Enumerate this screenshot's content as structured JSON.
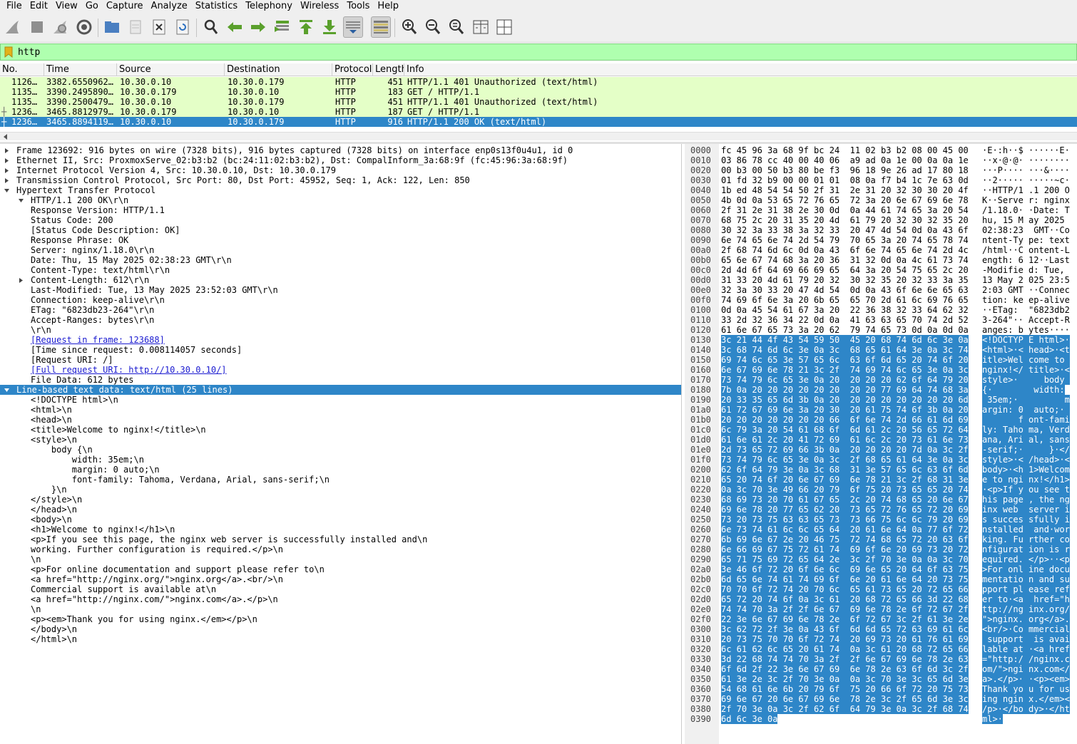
{
  "menu": [
    "File",
    "Edit",
    "View",
    "Go",
    "Capture",
    "Analyze",
    "Statistics",
    "Telephony",
    "Wireless",
    "Tools",
    "Help"
  ],
  "toolbar": {
    "buttons": [
      "start-capture",
      "stop-capture",
      "restart-capture",
      "capture-options",
      "open-file",
      "save-file",
      "close-file",
      "reload-file",
      "find-packet",
      "go-back",
      "go-forward",
      "go-to-packet",
      "first-packet",
      "last-packet",
      "auto-scroll",
      "colorize",
      "zoom-in",
      "zoom-out",
      "zoom-reset",
      "resize-columns",
      "layout"
    ]
  },
  "filter": {
    "value": "http"
  },
  "packet_list": {
    "columns": [
      "No.",
      "Time",
      "Source",
      "Destination",
      "Protocol",
      "Length",
      "Info"
    ],
    "rows": [
      {
        "mark": "",
        "no": "1126…",
        "time": "3382.6550962…",
        "source": "10.30.0.10",
        "destination": "10.30.0.179",
        "protocol": "HTTP",
        "length": "451",
        "info": "HTTP/1.1 401 Unauthorized  (text/html)",
        "selected": false
      },
      {
        "mark": "",
        "no": "1135…",
        "time": "3390.2495890…",
        "source": "10.30.0.179",
        "destination": "10.30.0.10",
        "protocol": "HTTP",
        "length": "183",
        "info": "GET / HTTP/1.1",
        "selected": false
      },
      {
        "mark": "",
        "no": "1135…",
        "time": "3390.2500479…",
        "source": "10.30.0.10",
        "destination": "10.30.0.179",
        "protocol": "HTTP",
        "length": "451",
        "info": "HTTP/1.1 401 Unauthorized  (text/html)",
        "selected": false
      },
      {
        "mark": "┼",
        "no": "1236…",
        "time": "3465.8812979…",
        "source": "10.30.0.179",
        "destination": "10.30.0.10",
        "protocol": "HTTP",
        "length": "187",
        "info": "GET / HTTP/1.1",
        "selected": false
      },
      {
        "mark": "┼",
        "no": "1236…",
        "time": "3465.8894119…",
        "source": "10.30.0.10",
        "destination": "10.30.0.179",
        "protocol": "HTTP",
        "length": "916",
        "info": "HTTP/1.1 200 OK  (text/html)",
        "selected": true
      }
    ]
  },
  "details": [
    {
      "indent": 0,
      "arrow": "right",
      "text": "Frame 123692: 916 bytes on wire (7328 bits), 916 bytes captured (7328 bits) on interface enp0s13f0u4u1, id 0"
    },
    {
      "indent": 0,
      "arrow": "right",
      "text": "Ethernet II, Src: ProxmoxServe_02:b3:b2 (bc:24:11:02:b3:b2), Dst: CompalInform_3a:68:9f (fc:45:96:3a:68:9f)"
    },
    {
      "indent": 0,
      "arrow": "right",
      "text": "Internet Protocol Version 4, Src: 10.30.0.10, Dst: 10.30.0.179"
    },
    {
      "indent": 0,
      "arrow": "right",
      "text": "Transmission Control Protocol, Src Port: 80, Dst Port: 45952, Seq: 1, Ack: 122, Len: 850"
    },
    {
      "indent": 0,
      "arrow": "down",
      "text": "Hypertext Transfer Protocol"
    },
    {
      "indent": 1,
      "arrow": "down",
      "text": "HTTP/1.1 200 OK\\r\\n"
    },
    {
      "indent": 2,
      "arrow": "",
      "text": "Response Version: HTTP/1.1"
    },
    {
      "indent": 2,
      "arrow": "",
      "text": "Status Code: 200"
    },
    {
      "indent": 2,
      "arrow": "",
      "text": "[Status Code Description: OK]"
    },
    {
      "indent": 2,
      "arrow": "",
      "text": "Response Phrase: OK"
    },
    {
      "indent": 1,
      "arrow": "",
      "text": "Server: nginx/1.18.0\\r\\n"
    },
    {
      "indent": 1,
      "arrow": "",
      "text": "Date: Thu, 15 May 2025 02:38:23 GMT\\r\\n"
    },
    {
      "indent": 1,
      "arrow": "",
      "text": "Content-Type: text/html\\r\\n"
    },
    {
      "indent": 1,
      "arrow": "right",
      "text": "Content-Length: 612\\r\\n"
    },
    {
      "indent": 1,
      "arrow": "",
      "text": "Last-Modified: Tue, 13 May 2025 23:52:03 GMT\\r\\n"
    },
    {
      "indent": 1,
      "arrow": "",
      "text": "Connection: keep-alive\\r\\n"
    },
    {
      "indent": 1,
      "arrow": "",
      "text": "ETag: \"6823db23-264\"\\r\\n"
    },
    {
      "indent": 1,
      "arrow": "",
      "text": "Accept-Ranges: bytes\\r\\n"
    },
    {
      "indent": 1,
      "arrow": "",
      "text": "\\r\\n"
    },
    {
      "indent": 1,
      "arrow": "",
      "text": "[Request in frame: 123688]",
      "link": true
    },
    {
      "indent": 1,
      "arrow": "",
      "text": "[Time since request: 0.008114057 seconds]"
    },
    {
      "indent": 1,
      "arrow": "",
      "text": "[Request URI: /]"
    },
    {
      "indent": 1,
      "arrow": "",
      "text": "[Full request URI: http://10.30.0.10/]",
      "link": true
    },
    {
      "indent": 1,
      "arrow": "",
      "text": "File Data: 612 bytes"
    },
    {
      "indent": 0,
      "arrow": "down",
      "text": "Line-based text data: text/html (25 lines)",
      "selected": true
    },
    {
      "indent": 1,
      "arrow": "",
      "text": "<!DOCTYPE html>\\n"
    },
    {
      "indent": 1,
      "arrow": "",
      "text": "<html>\\n"
    },
    {
      "indent": 1,
      "arrow": "",
      "text": "<head>\\n"
    },
    {
      "indent": 1,
      "arrow": "",
      "text": "<title>Welcome to nginx!</title>\\n"
    },
    {
      "indent": 1,
      "arrow": "",
      "text": "<style>\\n"
    },
    {
      "indent": 1,
      "arrow": "",
      "text": "    body {\\n"
    },
    {
      "indent": 1,
      "arrow": "",
      "text": "        width: 35em;\\n"
    },
    {
      "indent": 1,
      "arrow": "",
      "text": "        margin: 0 auto;\\n"
    },
    {
      "indent": 1,
      "arrow": "",
      "text": "        font-family: Tahoma, Verdana, Arial, sans-serif;\\n"
    },
    {
      "indent": 1,
      "arrow": "",
      "text": "    }\\n"
    },
    {
      "indent": 1,
      "arrow": "",
      "text": "</style>\\n"
    },
    {
      "indent": 1,
      "arrow": "",
      "text": "</head>\\n"
    },
    {
      "indent": 1,
      "arrow": "",
      "text": "<body>\\n"
    },
    {
      "indent": 1,
      "arrow": "",
      "text": "<h1>Welcome to nginx!</h1>\\n"
    },
    {
      "indent": 1,
      "arrow": "",
      "text": "<p>If you see this page, the nginx web server is successfully installed and\\n"
    },
    {
      "indent": 1,
      "arrow": "",
      "text": "working. Further configuration is required.</p>\\n"
    },
    {
      "indent": 1,
      "arrow": "",
      "text": "\\n"
    },
    {
      "indent": 1,
      "arrow": "",
      "text": "<p>For online documentation and support please refer to\\n"
    },
    {
      "indent": 1,
      "arrow": "",
      "text": "<a href=\"http://nginx.org/\">nginx.org</a>.<br/>\\n"
    },
    {
      "indent": 1,
      "arrow": "",
      "text": "Commercial support is available at\\n"
    },
    {
      "indent": 1,
      "arrow": "",
      "text": "<a href=\"http://nginx.com/\">nginx.com</a>.</p>\\n"
    },
    {
      "indent": 1,
      "arrow": "",
      "text": "\\n"
    },
    {
      "indent": 1,
      "arrow": "",
      "text": "<p><em>Thank you for using nginx.</em></p>\\n"
    },
    {
      "indent": 1,
      "arrow": "",
      "text": "</body>\\n"
    },
    {
      "indent": 1,
      "arrow": "",
      "text": "</html>\\n"
    }
  ],
  "bytes": {
    "highlight_start": 304,
    "rows": [
      {
        "offset": "0000",
        "hex": "fc 45 96 3a 68 9f bc 24  11 02 b3 b2 08 00 45 00",
        "ascii": "·E·:h··$ ······E·"
      },
      {
        "offset": "0010",
        "hex": "03 86 78 cc 40 00 40 06  a9 ad 0a 1e 00 0a 0a 1e",
        "ascii": "··x·@·@· ········"
      },
      {
        "offset": "0020",
        "hex": "00 b3 00 50 b3 80 be f3  96 18 9e 26 ad 17 80 18",
        "ascii": "···P···· ···&····"
      },
      {
        "offset": "0030",
        "hex": "01 fd 32 b9 00 00 01 01  08 0a f7 b4 1c 7e 63 0d",
        "ascii": "··2····· ·····~c·"
      },
      {
        "offset": "0040",
        "hex": "1b ed 48 54 54 50 2f 31  2e 31 20 32 30 30 20 4f",
        "ascii": "··HTTP/1 .1 200 O"
      },
      {
        "offset": "0050",
        "hex": "4b 0d 0a 53 65 72 76 65  72 3a 20 6e 67 69 6e 78",
        "ascii": "K··Serve r: nginx"
      },
      {
        "offset": "0060",
        "hex": "2f 31 2e 31 38 2e 30 0d  0a 44 61 74 65 3a 20 54",
        "ascii": "/1.18.0· ·Date: T"
      },
      {
        "offset": "0070",
        "hex": "68 75 2c 20 31 35 20 4d  61 79 20 32 30 32 35 20",
        "ascii": "hu, 15 M ay 2025 "
      },
      {
        "offset": "0080",
        "hex": "30 32 3a 33 38 3a 32 33  20 47 4d 54 0d 0a 43 6f",
        "ascii": "02:38:23  GMT··Co"
      },
      {
        "offset": "0090",
        "hex": "6e 74 65 6e 74 2d 54 79  70 65 3a 20 74 65 78 74",
        "ascii": "ntent-Ty pe: text"
      },
      {
        "offset": "00a0",
        "hex": "2f 68 74 6d 6c 0d 0a 43  6f 6e 74 65 6e 74 2d 4c",
        "ascii": "/html··C ontent-L"
      },
      {
        "offset": "00b0",
        "hex": "65 6e 67 74 68 3a 20 36  31 32 0d 0a 4c 61 73 74",
        "ascii": "ength: 6 12··Last"
      },
      {
        "offset": "00c0",
        "hex": "2d 4d 6f 64 69 66 69 65  64 3a 20 54 75 65 2c 20",
        "ascii": "-Modifie d: Tue, "
      },
      {
        "offset": "00d0",
        "hex": "31 33 20 4d 61 79 20 32  30 32 35 20 32 33 3a 35",
        "ascii": "13 May 2 025 23:5"
      },
      {
        "offset": "00e0",
        "hex": "32 3a 30 33 20 47 4d 54  0d 0a 43 6f 6e 6e 65 63",
        "ascii": "2:03 GMT ··Connec"
      },
      {
        "offset": "00f0",
        "hex": "74 69 6f 6e 3a 20 6b 65  65 70 2d 61 6c 69 76 65",
        "ascii": "tion: ke ep-alive"
      },
      {
        "offset": "0100",
        "hex": "0d 0a 45 54 61 67 3a 20  22 36 38 32 33 64 62 32",
        "ascii": "··ETag:  \"6823db2"
      },
      {
        "offset": "0110",
        "hex": "33 2d 32 36 34 22 0d 0a  41 63 63 65 70 74 2d 52",
        "ascii": "3-264\"·· Accept-R"
      },
      {
        "offset": "0120",
        "hex": "61 6e 67 65 73 3a 20 62  79 74 65 73 0d 0a 0d 0a",
        "ascii": "anges: b ytes····"
      },
      {
        "offset": "0130",
        "hex": "3c 21 44 4f 43 54 59 50  45 20 68 74 6d 6c 3e 0a",
        "ascii": "<!DOCTYP E html>·"
      },
      {
        "offset": "0140",
        "hex": "3c 68 74 6d 6c 3e 0a 3c  68 65 61 64 3e 0a 3c 74",
        "ascii": "<html>·< head>·<t"
      },
      {
        "offset": "0150",
        "hex": "69 74 6c 65 3e 57 65 6c  63 6f 6d 65 20 74 6f 20",
        "ascii": "itle>Wel come to "
      },
      {
        "offset": "0160",
        "hex": "6e 67 69 6e 78 21 3c 2f  74 69 74 6c 65 3e 0a 3c",
        "ascii": "nginx!</ title>·<"
      },
      {
        "offset": "0170",
        "hex": "73 74 79 6c 65 3e 0a 20  20 20 20 62 6f 64 79 20",
        "ascii": "style>·     body "
      },
      {
        "offset": "0180",
        "hex": "7b 0a 20 20 20 20 20 20  20 20 77 69 64 74 68 3a",
        "ascii": "{·        width:"
      },
      {
        "offset": "0190",
        "hex": "20 33 35 65 6d 3b 0a 20  20 20 20 20 20 20 20 6d",
        "ascii": " 35em;·         m"
      },
      {
        "offset": "01a0",
        "hex": "61 72 67 69 6e 3a 20 30  20 61 75 74 6f 3b 0a 20",
        "ascii": "argin: 0  auto;· "
      },
      {
        "offset": "01b0",
        "hex": "20 20 20 20 20 20 20 66  6f 6e 74 2d 66 61 6d 69",
        "ascii": "       f ont-fami"
      },
      {
        "offset": "01c0",
        "hex": "6c 79 3a 20 54 61 68 6f  6d 61 2c 20 56 65 72 64",
        "ascii": "ly: Taho ma, Verd"
      },
      {
        "offset": "01d0",
        "hex": "61 6e 61 2c 20 41 72 69  61 6c 2c 20 73 61 6e 73",
        "ascii": "ana, Ari al, sans"
      },
      {
        "offset": "01e0",
        "hex": "2d 73 65 72 69 66 3b 0a  20 20 20 20 7d 0a 3c 2f",
        "ascii": "-serif;·     }·</"
      },
      {
        "offset": "01f0",
        "hex": "73 74 79 6c 65 3e 0a 3c  2f 68 65 61 64 3e 0a 3c",
        "ascii": "style>·< /head>·<"
      },
      {
        "offset": "0200",
        "hex": "62 6f 64 79 3e 0a 3c 68  31 3e 57 65 6c 63 6f 6d",
        "ascii": "body>·<h 1>Welcom"
      },
      {
        "offset": "0210",
        "hex": "65 20 74 6f 20 6e 67 69  6e 78 21 3c 2f 68 31 3e",
        "ascii": "e to ngi nx!</h1>"
      },
      {
        "offset": "0220",
        "hex": "0a 3c 70 3e 49 66 20 79  6f 75 20 73 65 65 20 74",
        "ascii": "·<p>If y ou see t"
      },
      {
        "offset": "0230",
        "hex": "68 69 73 20 70 61 67 65  2c 20 74 68 65 20 6e 67",
        "ascii": "his page , the ng"
      },
      {
        "offset": "0240",
        "hex": "69 6e 78 20 77 65 62 20  73 65 72 76 65 72 20 69",
        "ascii": "inx web  server i"
      },
      {
        "offset": "0250",
        "hex": "73 20 73 75 63 63 65 73  73 66 75 6c 6c 79 20 69",
        "ascii": "s succes sfully i"
      },
      {
        "offset": "0260",
        "hex": "6e 73 74 61 6c 6c 65 64  20 61 6e 64 0a 77 6f 72",
        "ascii": "nstalled  and·wor"
      },
      {
        "offset": "0270",
        "hex": "6b 69 6e 67 2e 20 46 75  72 74 68 65 72 20 63 6f",
        "ascii": "king. Fu rther co"
      },
      {
        "offset": "0280",
        "hex": "6e 66 69 67 75 72 61 74  69 6f 6e 20 69 73 20 72",
        "ascii": "nfigurat ion is r"
      },
      {
        "offset": "0290",
        "hex": "65 71 75 69 72 65 64 2e  3c 2f 70 3e 0a 0a 3c 70",
        "ascii": "equired. </p>··<p"
      },
      {
        "offset": "02a0",
        "hex": "3e 46 6f 72 20 6f 6e 6c  69 6e 65 20 64 6f 63 75",
        "ascii": ">For onl ine docu"
      },
      {
        "offset": "02b0",
        "hex": "6d 65 6e 74 61 74 69 6f  6e 20 61 6e 64 20 73 75",
        "ascii": "mentatio n and su"
      },
      {
        "offset": "02c0",
        "hex": "70 70 6f 72 74 20 70 6c  65 61 73 65 20 72 65 66",
        "ascii": "pport pl ease ref"
      },
      {
        "offset": "02d0",
        "hex": "65 72 20 74 6f 0a 3c 61  20 68 72 65 66 3d 22 68",
        "ascii": "er to·<a  href=\"h"
      },
      {
        "offset": "02e0",
        "hex": "74 74 70 3a 2f 2f 6e 67  69 6e 78 2e 6f 72 67 2f",
        "ascii": "ttp://ng inx.org/"
      },
      {
        "offset": "02f0",
        "hex": "22 3e 6e 67 69 6e 78 2e  6f 72 67 3c 2f 61 3e 2e",
        "ascii": "\">nginx. org</a>."
      },
      {
        "offset": "0300",
        "hex": "3c 62 72 2f 3e 0a 43 6f  6d 6d 65 72 63 69 61 6c",
        "ascii": "<br/>·Co mmercial"
      },
      {
        "offset": "0310",
        "hex": "20 73 75 70 70 6f 72 74  20 69 73 20 61 76 61 69",
        "ascii": " support  is avai"
      },
      {
        "offset": "0320",
        "hex": "6c 61 62 6c 65 20 61 74  0a 3c 61 20 68 72 65 66",
        "ascii": "lable at ·<a href"
      },
      {
        "offset": "0330",
        "hex": "3d 22 68 74 74 70 3a 2f  2f 6e 67 69 6e 78 2e 63",
        "ascii": "=\"http:/ /nginx.c"
      },
      {
        "offset": "0340",
        "hex": "6f 6d 2f 22 3e 6e 67 69  6e 78 2e 63 6f 6d 3c 2f",
        "ascii": "om/\">ngi nx.com</"
      },
      {
        "offset": "0350",
        "hex": "61 3e 2e 3c 2f 70 3e 0a  0a 3c 70 3e 3c 65 6d 3e",
        "ascii": "a>.</p>· ·<p><em>"
      },
      {
        "offset": "0360",
        "hex": "54 68 61 6e 6b 20 79 6f  75 20 66 6f 72 20 75 73",
        "ascii": "Thank yo u for us"
      },
      {
        "offset": "0370",
        "hex": "69 6e 67 20 6e 67 69 6e  78 2e 3c 2f 65 6d 3e 3c",
        "ascii": "ing ngin x.</em><"
      },
      {
        "offset": "0380",
        "hex": "2f 70 3e 0a 3c 2f 62 6f  64 79 3e 0a 3c 2f 68 74",
        "ascii": "/p>·</bo dy>·</ht"
      },
      {
        "offset": "0390",
        "hex": "6d 6c 3e 0a",
        "ascii": "ml>·"
      }
    ]
  },
  "colors": {
    "filter_valid_bg": "#afffaf",
    "http_row_bg": "#e4ffc7",
    "selection_bg": "#2e86c8",
    "link_color": "#1a1ad0"
  }
}
